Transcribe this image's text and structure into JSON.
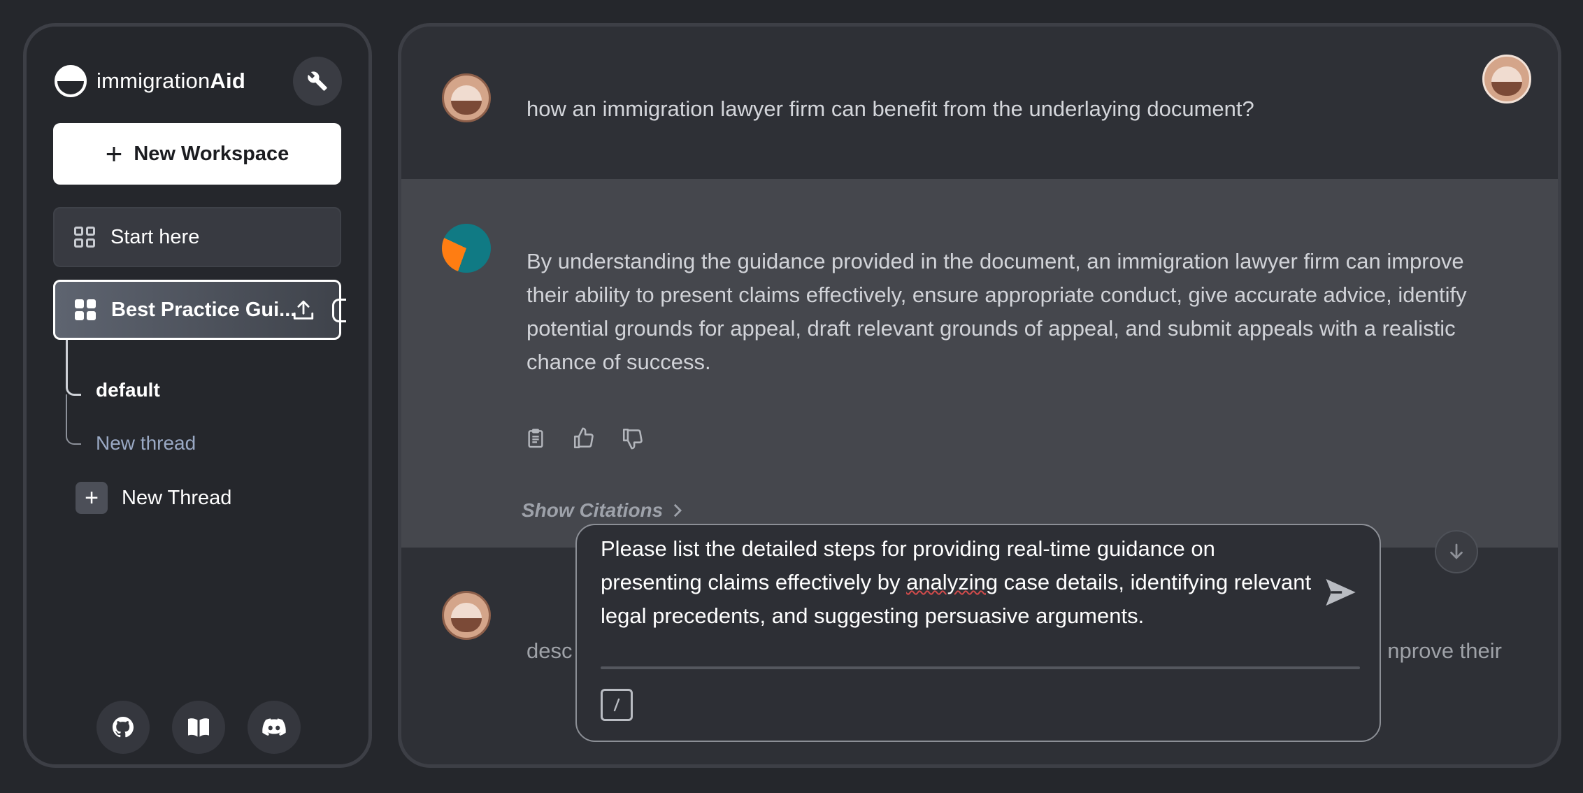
{
  "brand": {
    "prefix": "immigration",
    "suffix": "Aid"
  },
  "sidebar": {
    "new_workspace_label": "New Workspace",
    "workspaces": [
      {
        "label": "Start here"
      },
      {
        "label": "Best Practice Gui...",
        "active": true
      }
    ],
    "threads": [
      {
        "label": "default",
        "active": true
      },
      {
        "label": "New thread"
      }
    ],
    "new_thread_label": "New Thread",
    "footer_icons": [
      "github-icon",
      "docs-book-icon",
      "discord-icon"
    ]
  },
  "chat": {
    "messages": [
      {
        "role": "user",
        "text": "how an immigration lawyer firm can benefit from the underlaying document?"
      },
      {
        "role": "assistant",
        "text": "By understanding the guidance provided in the document, an immigration lawyer firm can improve their ability to present claims effectively, ensure appropriate conduct, give accurate advice, identify potential grounds for appeal, draft relevant grounds of appeal, and submit appeals with a realistic chance of success."
      },
      {
        "role": "user",
        "text_left": "desc",
        "text_right": "nprove their"
      }
    ],
    "show_citations_label": "Show Citations"
  },
  "prompt": {
    "text_part1": "Please list the detailed steps for providing real-time guidance on presenting claims effectively by ",
    "misspelled_word": "analyzing",
    "text_part2": " case details, identifying relevant legal precedents, and suggesting persuasive arguments."
  },
  "colors": {
    "background": "#25272c",
    "panel": "#2e3036",
    "assistant_bg": "#45474d",
    "accent_link": "#9aa9c4",
    "ai_orange": "#ff7d12",
    "ai_teal": "#107a84"
  }
}
